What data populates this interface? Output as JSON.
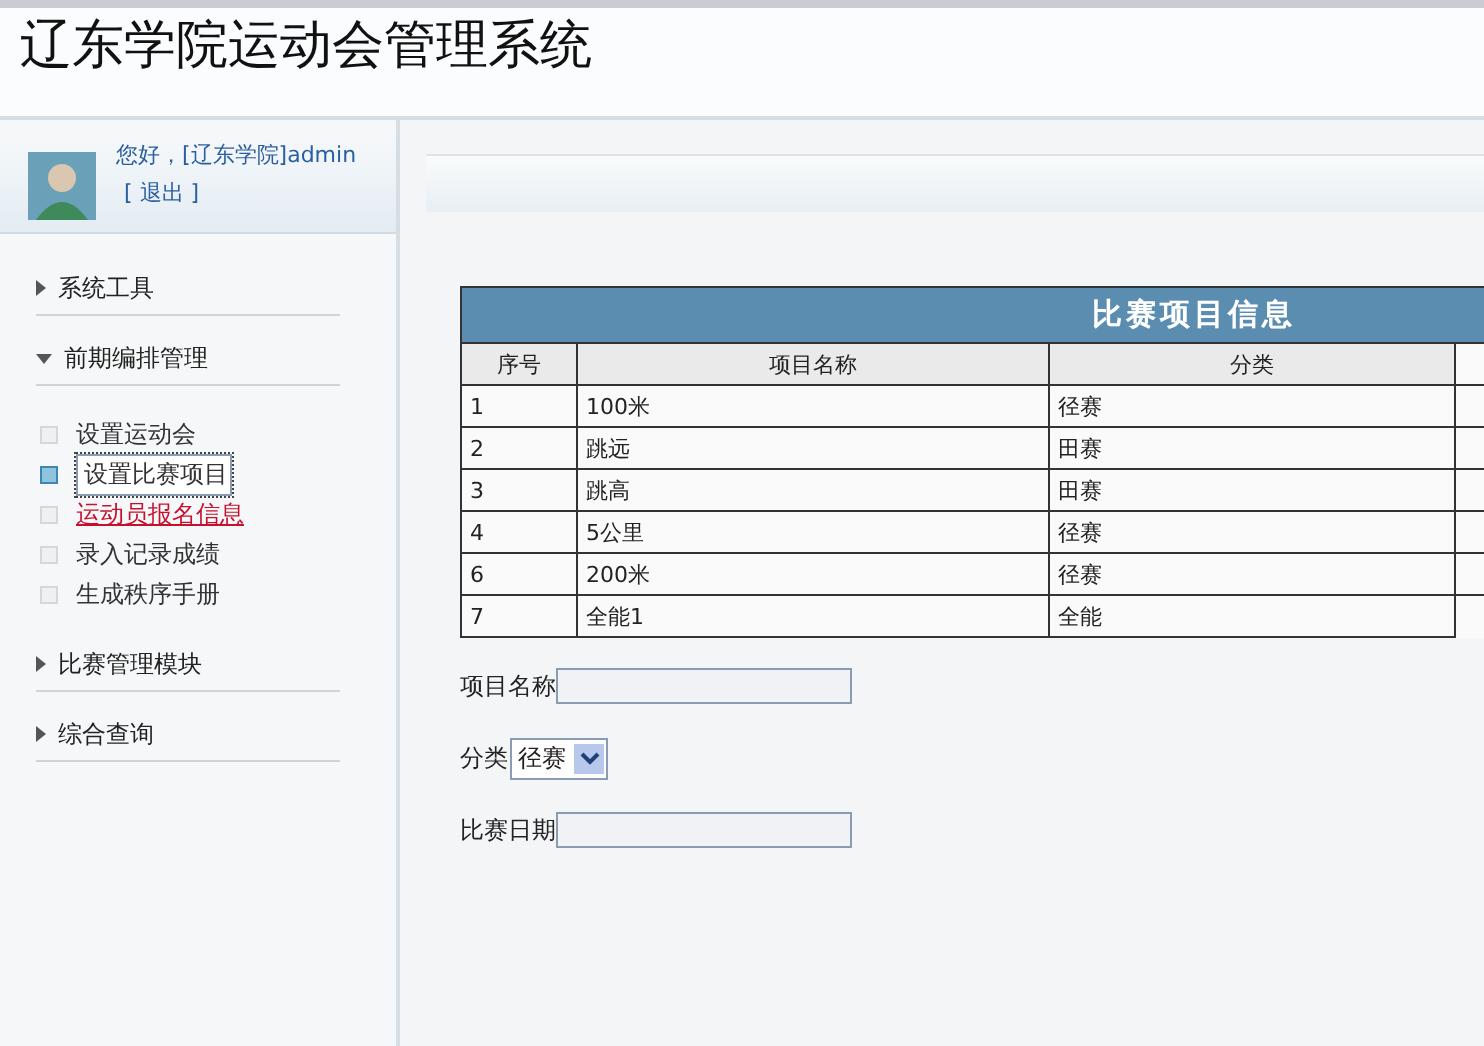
{
  "header": {
    "title": "辽东学院运动会管理系统"
  },
  "user": {
    "greeting": "您好，[辽东学院]admin",
    "logout": "[ 退出 ]"
  },
  "sidebar": {
    "sections": [
      {
        "label": "系统工具",
        "expanded": false
      },
      {
        "label": "前期编排管理",
        "expanded": true,
        "children": [
          {
            "label": "设置运动会",
            "selected": false,
            "hovered": false
          },
          {
            "label": "设置比赛项目",
            "selected": true,
            "hovered": false
          },
          {
            "label": "运动员报名信息",
            "selected": false,
            "hovered": true
          },
          {
            "label": "录入记录成绩",
            "selected": false,
            "hovered": false
          },
          {
            "label": "生成秩序手册",
            "selected": false,
            "hovered": false
          }
        ]
      },
      {
        "label": "比赛管理模块",
        "expanded": false
      },
      {
        "label": "综合查询",
        "expanded": false
      }
    ]
  },
  "table": {
    "title": "比赛项目信息",
    "columns": [
      "序号",
      "项目名称",
      "分类"
    ],
    "rows": [
      [
        "1",
        "100米",
        "径赛"
      ],
      [
        "2",
        "跳远",
        "田赛"
      ],
      [
        "3",
        "跳高",
        "田赛"
      ],
      [
        "4",
        "5公里",
        "径赛"
      ],
      [
        "6",
        "200米",
        "径赛"
      ],
      [
        "7",
        "全能1",
        "全能"
      ]
    ]
  },
  "form": {
    "fields": [
      {
        "kind": "text",
        "label": "项目名称"
      },
      {
        "kind": "select",
        "label": "分类",
        "value": "径赛"
      },
      {
        "kind": "text",
        "label": "比赛日期"
      }
    ]
  }
}
